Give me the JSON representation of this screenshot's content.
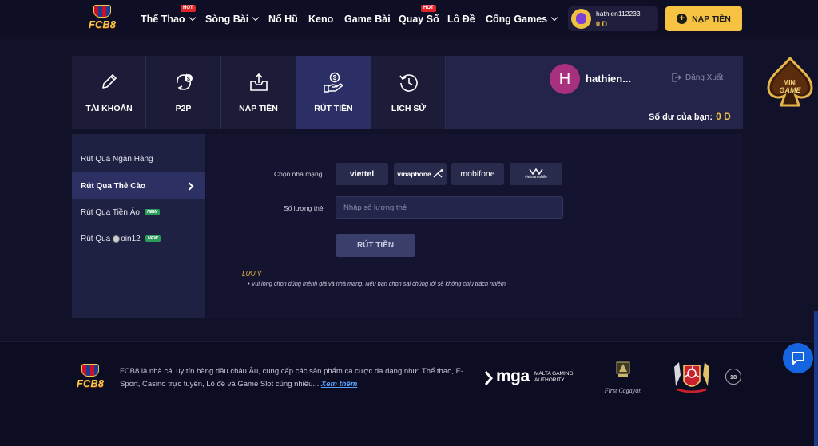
{
  "header": {
    "logo_text": "FCB8",
    "nav": [
      {
        "label": "Thể Thao",
        "dropdown": true,
        "hot": true
      },
      {
        "label": "Sòng Bài",
        "dropdown": true,
        "hot": false
      },
      {
        "label": "Nổ Hũ",
        "dropdown": false,
        "hot": false
      },
      {
        "label": "Keno",
        "dropdown": false,
        "hot": false
      },
      {
        "label": "Game Bài",
        "dropdown": false,
        "hot": false
      },
      {
        "label": "Quay Số",
        "dropdown": false,
        "hot": true
      },
      {
        "label": "Lô Đề",
        "dropdown": false,
        "hot": false
      },
      {
        "label": "Cổng Games",
        "dropdown": true,
        "hot": false
      }
    ],
    "hot_badge": "HOT",
    "user": {
      "name": "hathien112233",
      "balance": "0 D"
    },
    "deposit_button": "NẠP TIỀN"
  },
  "account": {
    "tabs": [
      {
        "label": "TÀI KHOẢN",
        "icon": "pencil-icon",
        "active": false
      },
      {
        "label": "P2P",
        "icon": "p2p-exchange-icon",
        "active": false
      },
      {
        "label": "NẠP TIỀN",
        "icon": "upload-box-icon",
        "active": false
      },
      {
        "label": "RÚT TIỀN",
        "icon": "hand-coin-icon",
        "active": true
      },
      {
        "label": "LỊCH SỬ",
        "icon": "history-clock-icon",
        "active": false
      }
    ],
    "profile": {
      "initial": "H",
      "name": "hathien...",
      "logout": "Đăng Xuất"
    },
    "balance_label": "Số dư của bạn:",
    "balance_value": "0 D"
  },
  "sidebar": {
    "items": [
      {
        "label": "Rút Qua Ngân Hàng",
        "active": false,
        "new": false
      },
      {
        "label": "Rút Qua Thẻ Cào",
        "active": true,
        "new": false
      },
      {
        "label": "Rút Qua Tiền Ảo",
        "active": false,
        "new": true
      },
      {
        "label": "Rút Qua",
        "coin_label": "oin12",
        "active": false,
        "new": true
      }
    ],
    "new_badge": "NEW"
  },
  "form": {
    "carrier_label": "Chọn nhà mạng",
    "carriers": [
      "viettel",
      "vinaphone",
      "mobifone",
      "vietnamobile"
    ],
    "quantity_label": "Số lượng thẻ",
    "quantity_placeholder": "Nhập số lượng thẻ",
    "submit": "RÚT TIỀN",
    "note_title": "LƯU Ý",
    "note_text": "Vui lòng chọn đúng mệnh giá và nhà mạng. Nếu bạn chọn sai chúng tôi sẽ không chịu trách nhiệm."
  },
  "footer": {
    "logo_text": "FCB8",
    "description": "FCB8 là nhà cái uy tín hàng đầu châu Âu, cung cấp các sản phẩm cá cược đa dạng như: Thể thao, E-Sport, Casino trực tuyến, Lô đề và Game Slot cùng nhiều...",
    "more_link": "Xem thêm",
    "mga_big": "mga",
    "mga_small": "MALTA GAMING AUTHORITY",
    "cagayan": "First Cagayan",
    "age": "18"
  },
  "floating": {
    "mini_game_line1": "MINI",
    "mini_game_line2": "GAME"
  },
  "colors": {
    "accent_gold": "#f5c242",
    "active_tab": "#2c2f66",
    "hot_red": "#e0262b",
    "new_green": "#2a9d5b",
    "chat_blue": "#1565e0"
  }
}
